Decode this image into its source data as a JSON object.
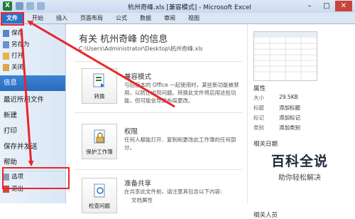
{
  "window": {
    "title": "杭州奇峰.xls [兼容模式] - Microsoft Excel",
    "controls": [
      "–",
      "□",
      "✕"
    ]
  },
  "tabs": [
    "文件",
    "开始",
    "插入",
    "页面布局",
    "公式",
    "数据",
    "审阅",
    "视图"
  ],
  "nav": {
    "save": "保存",
    "save_as": "另存为",
    "open": "打开",
    "close": "关闭",
    "info": "信息",
    "recent": "最近所用文件",
    "new": "新建",
    "print": "打印",
    "save_send": "保存并发送",
    "help": "帮助",
    "options": "选项",
    "exit": "退出"
  },
  "content": {
    "title": "有关 杭州奇峰 的信息",
    "path": "C:\\Users\\Administrator\\Desktop\\杭州奇峰.xls",
    "compat": {
      "button": "转换",
      "title": "兼容模式",
      "desc": "与旧版本的 Office 一起使用时，某些新功能被禁用，以防止出现问题。转换此文件将启用这些功能，但可能会导致布局更改。"
    },
    "perm": {
      "button": "保护工作簿",
      "title": "权限",
      "desc": "任何人都能打开、复制和更改此工作簿的任何部分。"
    },
    "share": {
      "button": "检查问题",
      "title": "准备共享",
      "desc1": "在共享此文件前，请注意其包含以下内容:",
      "desc2": "文档属性"
    }
  },
  "props": {
    "header": "属性",
    "rows": [
      {
        "k": "大小",
        "v": "29.5KB"
      },
      {
        "k": "标题",
        "v": "添加标题"
      },
      {
        "k": "标记",
        "v": "添加标记"
      },
      {
        "k": "类别",
        "v": "添加类别"
      }
    ],
    "related_dates": "相关日期",
    "related_people": "相关人员"
  },
  "watermark": {
    "title": "百科全说",
    "subtitle": "助你轻松解决"
  },
  "colors": {
    "accent_blue": "#2b73c9",
    "annotation_red": "#e8262a",
    "excel_green": "#1f7a3a"
  }
}
